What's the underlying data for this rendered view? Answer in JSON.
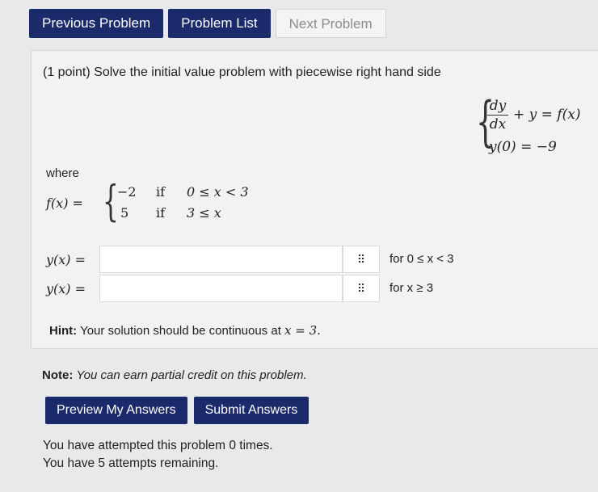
{
  "nav": {
    "previous": "Previous Problem",
    "list": "Problem List",
    "next": "Next Problem"
  },
  "problem": {
    "intro": "(1 point) Solve the initial value problem with piecewise right hand side",
    "system": {
      "dy": "dy",
      "dx": "dx",
      "eq1_rest": "+ y = f(x)",
      "eq2": "y(0) = −9"
    },
    "where": "where",
    "piecewise": {
      "lhs": "f(x) =",
      "rows": [
        {
          "value": "−2",
          "if": "if",
          "cond": "0 ≤ x < 3"
        },
        {
          "value": "5",
          "if": "if",
          "cond": "3 ≤ x"
        }
      ]
    },
    "answers": [
      {
        "label": "y(x) =",
        "value": "",
        "grid_icon": "⠿",
        "condition": "for 0 ≤ x < 3"
      },
      {
        "label": "y(x) =",
        "value": "",
        "grid_icon": "⠿",
        "condition": "for x ≥ 3"
      }
    ],
    "hint": {
      "label": "Hint:",
      "text": "Your solution should be continuous at",
      "math": "x = 3."
    }
  },
  "note": {
    "label": "Note:",
    "text": "You can earn partial credit on this problem."
  },
  "actions": {
    "preview": "Preview My Answers",
    "submit": "Submit Answers"
  },
  "attempts": {
    "line1": "You have attempted this problem 0 times.",
    "line2": "You have 5 attempts remaining."
  },
  "colors": {
    "primary_button": "#1b2a6b",
    "disabled_button_text": "#8a8d92",
    "panel_bg": "#f1f2f3"
  }
}
